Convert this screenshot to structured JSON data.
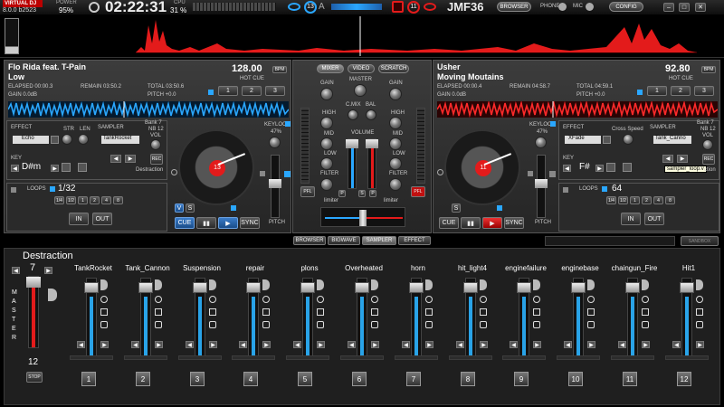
{
  "topbar": {
    "brand": "VIRTUAL DJ",
    "brand_version": "8.0.0 b2523",
    "power_label": "POWER",
    "power_value": "95%",
    "clock": "02:22:31",
    "cpu_label": "CPU",
    "cpu_value": "31 %",
    "deck_left_num": "13",
    "deck_right_num": "11",
    "center_letter": "A",
    "user": "JMF36",
    "browser": "BROWSER",
    "phone": "PHONE",
    "mic": "MIC",
    "config": "CONFIG",
    "minimize": "–",
    "maximize": "□",
    "close": "✕"
  },
  "deck_left": {
    "artist": "Flo Rida feat. T-Pain",
    "title": "Low",
    "bpm": "128.00",
    "bpm_label": "BPM",
    "hotcue": "HOT CUE",
    "elapsed": "ELAPSED 00:00.3",
    "remain": "REMAIN 03:50.2",
    "total": "TOTAL 03:50.6",
    "gain": "GAIN 0.0dB",
    "pitch": "PITCH +0.0",
    "cues": [
      "1",
      "2",
      "3"
    ],
    "effect_label": "EFFECT",
    "effect_value": "Echo",
    "str": "STR",
    "len": "LEN",
    "sampler_label": "SAMPLER",
    "bank": "Bank 7",
    "nb": "NB 12",
    "vol": "VOL",
    "sampler_value": "TankRocket",
    "sampler_name": "Destraction",
    "rec": "REC",
    "key_label": "KEY",
    "key_value": "D#m",
    "keylock": "KEYLOCK",
    "keylock_value": "47%",
    "loops_label": "LOOPS",
    "loop_value": "1/32",
    "loop_sizes": [
      "1/4",
      "1/2",
      "1",
      "2",
      "4",
      "8"
    ],
    "in": "IN",
    "out": "OUT",
    "v": "V",
    "s": "S",
    "cue": "CUE",
    "play_pause": "▮▮",
    "play": "▶",
    "sync": "SYNC",
    "pitch_label": "PITCH",
    "jog_num": "13"
  },
  "deck_right": {
    "artist": "Usher",
    "title": "Moving Moutains",
    "bpm": "92.80",
    "bpm_label": "BPM",
    "hotcue": "HOT CUE",
    "elapsed": "ELAPSED 00:00.4",
    "remain": "REMAIN 04:58.7",
    "total": "TOTAL 04:59.1",
    "gain": "GAIN 0.0dB",
    "pitch": "PITCH +0.0",
    "cues": [
      "1",
      "2",
      "3"
    ],
    "effect_label": "EFFECT",
    "effect_value": "XFade",
    "cross_speed": "Cross Speed",
    "sampler_label": "SAMPLER",
    "bank": "Bank 7",
    "nb": "NB 12",
    "vol": "VOL",
    "sampler_value": "Tank_Canno",
    "sampler_name": "ction",
    "tooltip": "sampler_loop.v",
    "rec": "REC",
    "key_label": "KEY",
    "key_value": "F#",
    "keylock": "KEYLOCK",
    "keylock_value": "47%",
    "loops_label": "LOOPS",
    "loop_value": "64",
    "loop_sizes": [
      "1/4",
      "1/2",
      "1",
      "2",
      "4",
      "8"
    ],
    "in": "IN",
    "out": "OUT",
    "s": "S",
    "cue": "CUE",
    "play_pause": "▮▮",
    "play": "▶",
    "sync": "SYNC",
    "pitch_label": "PITCH",
    "jog_num": "11"
  },
  "mixer": {
    "tabs": [
      "MIXER",
      "VIDEO",
      "SCRATCH"
    ],
    "gain": "GAIN",
    "master": "MASTER",
    "high": "HIGH",
    "mid": "MID",
    "low": "LOW",
    "cmix": "C.MIX",
    "bal": "BAL",
    "volume": "VOLUME",
    "filter": "FILTER",
    "limiter": "limiter",
    "pfl": "PFL",
    "p": "P",
    "s": "S"
  },
  "bottom_tabs": [
    "BROWSER",
    "BIGWAVE",
    "SAMPLER",
    "EFFECT"
  ],
  "sandbox": "SANDBOX",
  "sampler": {
    "title": "Destraction",
    "master_num": "7",
    "master_label": "M A S T E R",
    "stop": "STOP",
    "count": "12",
    "channels": [
      {
        "name": "TankRocket",
        "level": 0.75,
        "num": "1"
      },
      {
        "name": "Tank_Cannon",
        "level": 0.75,
        "num": "2"
      },
      {
        "name": "Suspension",
        "level": 0.75,
        "num": "3"
      },
      {
        "name": "repair",
        "level": 0.75,
        "num": "4"
      },
      {
        "name": "plons",
        "level": 0.75,
        "num": "5"
      },
      {
        "name": "Overheated",
        "level": 0.75,
        "num": "6"
      },
      {
        "name": "horn",
        "level": 0.75,
        "num": "7"
      },
      {
        "name": "hit_light4",
        "level": 0.75,
        "num": "8"
      },
      {
        "name": "enginefailure",
        "level": 0.75,
        "num": "9"
      },
      {
        "name": "enginebase",
        "level": 0.75,
        "num": "10"
      },
      {
        "name": "chaingun_Fire",
        "level": 0.75,
        "num": "11"
      },
      {
        "name": "Hit1",
        "level": 0.75,
        "num": "12"
      }
    ]
  },
  "colors": {
    "accent_blue": "#29a3e8",
    "accent_red": "#e31b1b",
    "waveform_left": "#2aa7ff",
    "waveform_right": "#ff2a2a"
  }
}
